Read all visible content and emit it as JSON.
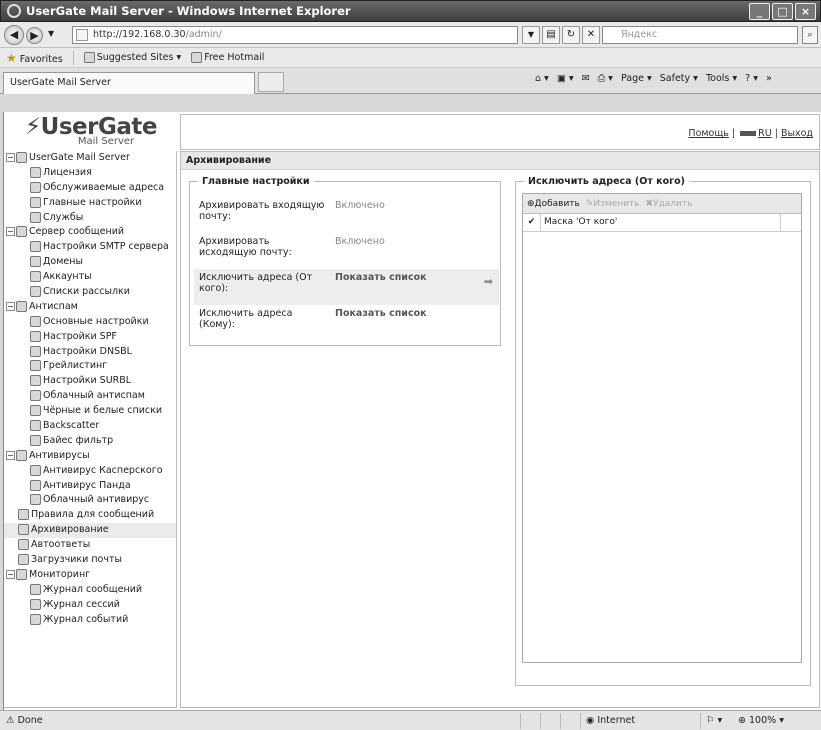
{
  "window": {
    "title": "UserGate Mail Server - Windows Internet Explorer"
  },
  "browser": {
    "url_host": "http://192.168.0.30",
    "url_path": "/admin/",
    "search_placeholder": "Яндекс",
    "favorites": "Favorites",
    "suggested": "Suggested Sites ▾",
    "hotmail": "Free Hotmail",
    "tab_title": "UserGate Mail Server",
    "cmd": {
      "page": "Page ▾",
      "safety": "Safety ▾",
      "tools": "Tools ▾"
    }
  },
  "logo": {
    "name": "UserGate",
    "sub": "Mail Server"
  },
  "header": {
    "help": "Помощь",
    "lang": "RU",
    "logout": "Выход"
  },
  "tree": [
    {
      "label": "UserGate Mail Server",
      "level": 0,
      "toggle": "⊟"
    },
    {
      "label": "Лицензия",
      "level": 2
    },
    {
      "label": "Обслуживаемые адреса",
      "level": 2
    },
    {
      "label": "Главные настройки",
      "level": 2
    },
    {
      "label": "Службы",
      "level": 2
    },
    {
      "label": "Сервер сообщений",
      "level": 0,
      "toggle": "⊟"
    },
    {
      "label": "Настройки SMTP сервера",
      "level": 2
    },
    {
      "label": "Домены",
      "level": 2
    },
    {
      "label": "Аккаунты",
      "level": 2
    },
    {
      "label": "Списки рассылки",
      "level": 2
    },
    {
      "label": "Антиспам",
      "level": 0,
      "toggle": "⊟"
    },
    {
      "label": "Основные настройки",
      "level": 2
    },
    {
      "label": "Настройки SPF",
      "level": 2
    },
    {
      "label": "Настройки DNSBL",
      "level": 2
    },
    {
      "label": "Грейлистинг",
      "level": 2
    },
    {
      "label": "Настройки SURBL",
      "level": 2
    },
    {
      "label": "Облачный антиспам",
      "level": 2
    },
    {
      "label": "Чёрные и белые списки",
      "level": 2
    },
    {
      "label": "Backscatter",
      "level": 2
    },
    {
      "label": "Байес фильтр",
      "level": 2
    },
    {
      "label": "Антивирусы",
      "level": 0,
      "toggle": "⊟"
    },
    {
      "label": "Антивирус Касперского",
      "level": 2
    },
    {
      "label": "Антивирус Панда",
      "level": 2
    },
    {
      "label": "Облачный антивирус",
      "level": 2
    },
    {
      "label": "Правила для сообщений",
      "level": 1
    },
    {
      "label": "Архивирование",
      "level": 1,
      "selected": true
    },
    {
      "label": "Автоответы",
      "level": 1
    },
    {
      "label": "Загрузчики почты",
      "level": 1
    },
    {
      "label": "Мониторинг",
      "level": 0,
      "toggle": "⊟"
    },
    {
      "label": "Журнал сообщений",
      "level": 2
    },
    {
      "label": "Журнал сессий",
      "level": 2
    },
    {
      "label": "Журнал событий",
      "level": 2
    }
  ],
  "main": {
    "title": "Архивирование",
    "settings": {
      "legend": "Главные настройки",
      "rows": [
        {
          "label": "Архивировать входящую почту:",
          "value": "Включено"
        },
        {
          "label": "Архивировать исходящую почту:",
          "value": "Включено"
        },
        {
          "label": "Исключить адреса (От кого):",
          "value": "Показать список"
        },
        {
          "label": "Исключить адреса (Кому):",
          "value": "Показать список"
        }
      ]
    },
    "exclude": {
      "legend": "Исключить адреса (От кого)",
      "add": "Добавить",
      "edit": "Изменить",
      "delete": "Удалить",
      "column": "Маска 'От кого'"
    }
  },
  "status": {
    "done": "Done",
    "zone": "Internet",
    "zoom": "100%"
  }
}
